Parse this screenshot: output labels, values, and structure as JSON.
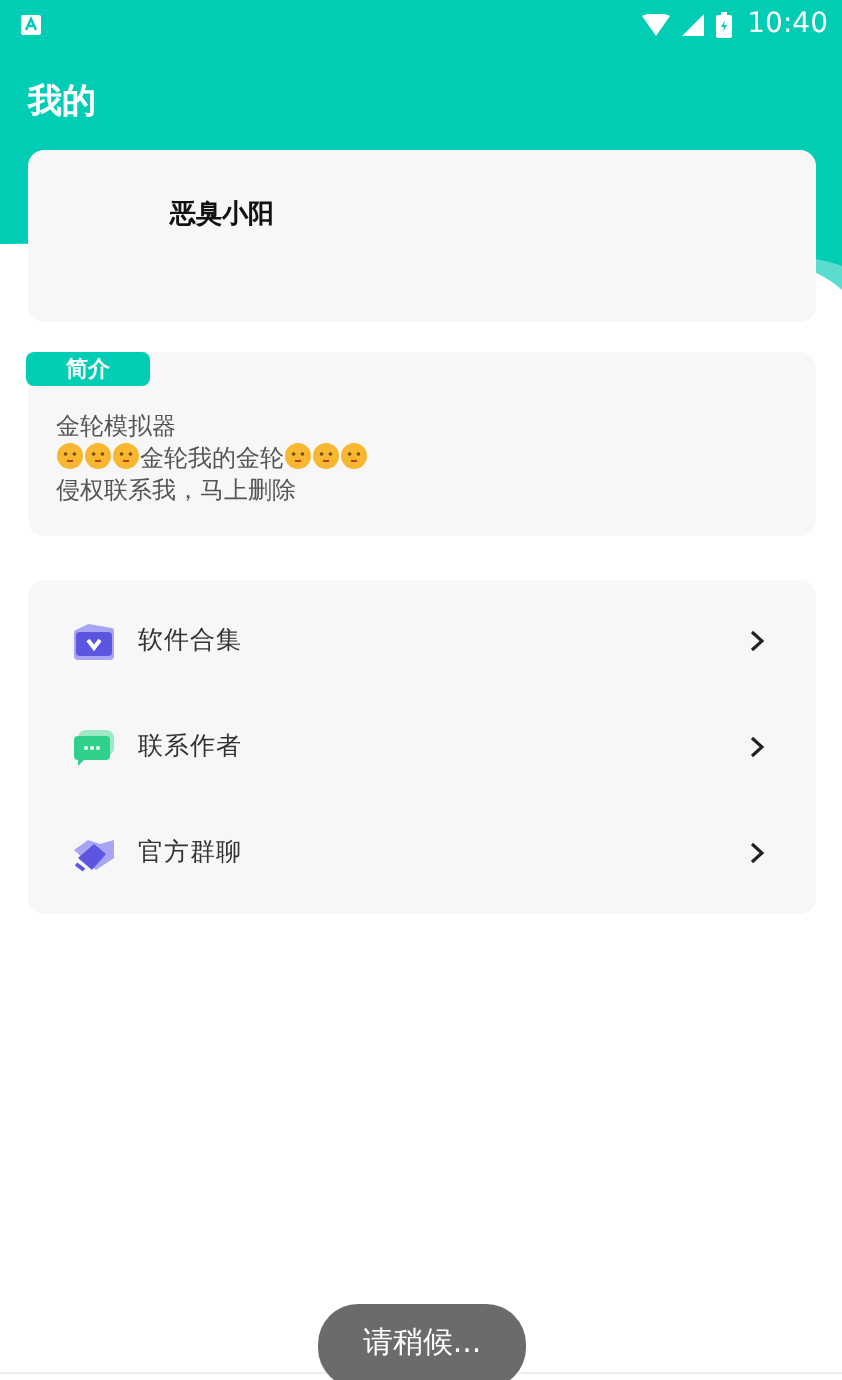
{
  "status_bar": {
    "time": "10:40"
  },
  "header": {
    "title": "我的"
  },
  "profile": {
    "name": "恶臭小阳"
  },
  "intro": {
    "tag": "简介",
    "lines": [
      {
        "parts": [
          {
            "kind": "text",
            "text": "金轮模拟器"
          }
        ]
      },
      {
        "parts": [
          {
            "kind": "emoji"
          },
          {
            "kind": "emoji"
          },
          {
            "kind": "emoji"
          },
          {
            "kind": "text",
            "text": "金轮我的金轮"
          },
          {
            "kind": "emoji"
          },
          {
            "kind": "emoji"
          },
          {
            "kind": "emoji"
          }
        ]
      },
      {
        "parts": [
          {
            "kind": "text",
            "text": "侵权联系我，马上删除"
          }
        ]
      }
    ]
  },
  "menu": [
    {
      "kind": "apps",
      "label": "软件合集"
    },
    {
      "kind": "chat",
      "label": "联系作者"
    },
    {
      "kind": "group",
      "label": "官方群聊"
    }
  ],
  "toast": {
    "text": "请稍候..."
  }
}
